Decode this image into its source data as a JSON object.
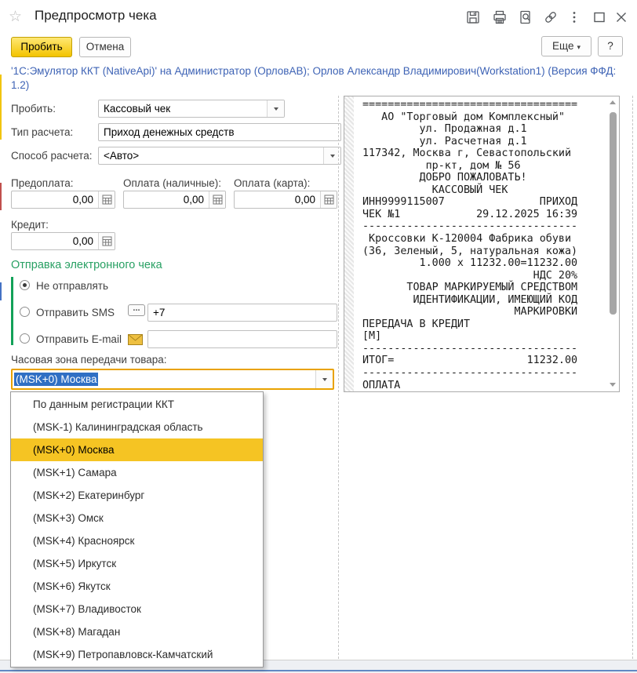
{
  "window": {
    "title": "Предпросмотр чека"
  },
  "titlebar": {
    "icons": [
      "save-icon",
      "print-icon",
      "preview-icon",
      "link-icon",
      "more-vert-icon",
      "maximize-icon",
      "close-icon"
    ]
  },
  "toolbar": {
    "commit_label": "Пробить",
    "cancel_label": "Отмена",
    "more_label": "Еще",
    "more_caret": "▾",
    "help_label": "?"
  },
  "device_info": "'1С:Эмулятор ККТ (NativeApi)' на Администратор (ОрловАВ); Орлов Александр Владимирович(Workstation1) (Версия ФФД: 1.2)",
  "form": {
    "fields": [
      {
        "label": "Пробить:",
        "value": "Кассовый чек"
      },
      {
        "label": "Тип расчета:",
        "value": "Приход денежных средств"
      },
      {
        "label": "Способ расчета:",
        "value": "<Авто>"
      }
    ],
    "amounts": [
      {
        "label": "Предоплата:",
        "value": "0,00"
      },
      {
        "label": "Оплата (наличные):",
        "value": "0,00"
      },
      {
        "label": "Оплата (карта):",
        "value": "0,00"
      },
      {
        "label": "Кредит:",
        "value": "0,00"
      }
    ],
    "send": {
      "title": "Отправка электронного чека",
      "options": [
        {
          "label": "Не отправлять",
          "selected": true
        },
        {
          "label": "Отправить SMS",
          "selected": false,
          "input": "+7",
          "icon": "sms-dots-icon"
        },
        {
          "label": "Отправить E-mail",
          "selected": false,
          "input": "",
          "icon": "envelope-icon"
        }
      ],
      "sms_dots": "..."
    },
    "timezone": {
      "label": "Часовая зона передачи товара:",
      "value": "(MSK+0) Москва"
    }
  },
  "dropdown": {
    "selected_index": 2,
    "items": [
      "По данным регистрации ККТ",
      "(MSK-1) Калининградская область",
      "(MSK+0) Москва",
      "(MSK+1) Самара",
      "(MSK+2) Екатеринбург",
      "(MSK+3) Омск",
      "(MSK+4) Красноярск",
      "(MSK+5) Иркутск",
      "(MSK+6) Якутск",
      "(MSK+7) Владивосток",
      "(MSK+8) Магадан",
      "(MSK+9) Петропавловск-Камчатский"
    ]
  },
  "receipt": {
    "lines": [
      "==================================",
      "   АО \"Торговый дом Комплексный\"",
      "         ул. Продажная д.1",
      "         ул. Расчетная д.1",
      "117342, Москва г, Севастопольский",
      "          пр-кт, дом № 56",
      "         ДОБРО ПОЖАЛОВАТЬ!",
      "           КАССОВЫЙ ЧЕК",
      "ИНН9999115007               ПРИХОД",
      "ЧЕК №1            29.12.2025 16:39",
      "----------------------------------",
      " Кроссовки К-120004 Фабрика обуви",
      "(36, Зеленый, 5, натуральная кожа)",
      "         1.000 х 11232.00=11232.00",
      "                           НДС 20%",
      "       ТОВАР МАРКИРУЕМЫЙ СРЕДСТВОМ",
      "        ИДЕНТИФИКАЦИИ, ИМЕЮЩИЙ КОД",
      "                        МАРКИРОВКИ",
      "ПЕРЕДАЧА В КРЕДИТ",
      "[М]",
      "----------------------------------",
      "ИТОГ=                     11232.00",
      "----------------------------------",
      "ОПЛАТА"
    ]
  },
  "colors": {
    "accent_yellow": "#f3c300",
    "focus_border": "#e9a200",
    "highlight_row": "#f5c423",
    "link_blue": "#3e63b5",
    "section_green": "#28a063",
    "selection_blue": "#2f6fc4"
  }
}
